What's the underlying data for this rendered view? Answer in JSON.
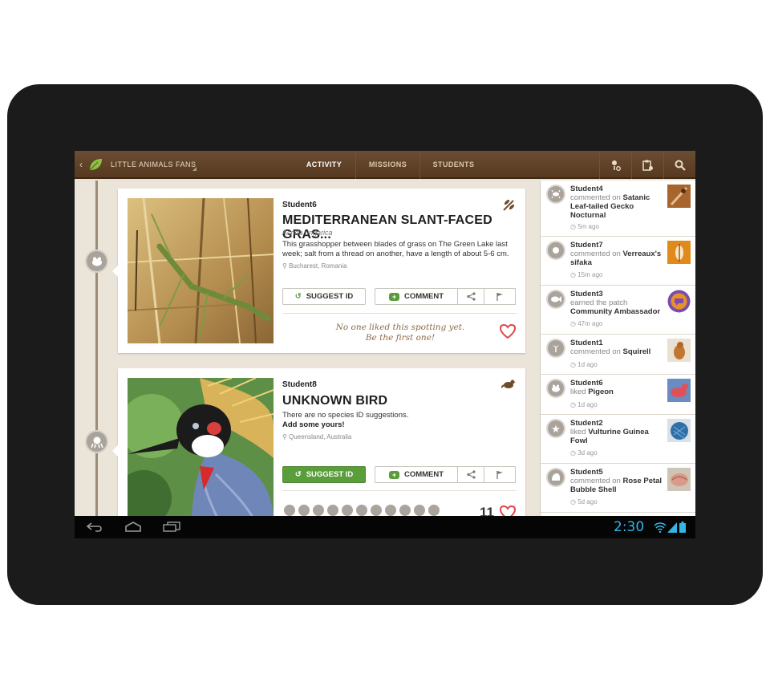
{
  "topbar": {
    "group_name": "LITTLE ANIMALS FANS",
    "tabs": [
      {
        "label": "ACTIVITY",
        "active": true
      },
      {
        "label": "MISSIONS",
        "active": false
      },
      {
        "label": "STUDENTS",
        "active": false
      }
    ],
    "icons": [
      "person-settings-icon",
      "clipboard-icon",
      "search-icon"
    ]
  },
  "feed": {
    "cards": [
      {
        "user": "Student6",
        "title": "MEDITERRANEAN SLANT-FACED GRAS...",
        "scientific": "Acrida ungarica",
        "description": "This grasshopper between blades of grass on The Green Lake last week; salt from a thread on another, have a length of about 5-6 cm.",
        "location": "Bucharest, Romania",
        "category_icon": "dragonfly-icon",
        "suggest_label": "SUGGEST ID",
        "comment_label": "COMMENT",
        "likes_text_1": "No one liked this spotting yet.",
        "likes_text_2": "Be the first one!"
      },
      {
        "user": "Student8",
        "title": "UNKNOWN BIRD",
        "description": "There are no species ID suggestions.",
        "add_prompt": "Add some yours!",
        "location": "Queensland, Australia",
        "category_icon": "bird-icon",
        "suggest_label": "SUGGEST ID",
        "comment_label": "COMMENT",
        "likes_count": "11"
      }
    ]
  },
  "sidebar": {
    "items": [
      {
        "user": "Student4",
        "action": "commented on",
        "target": "Satanic Leaf-tailed Gecko Nocturnal",
        "time": "5m ago"
      },
      {
        "user": "Student7",
        "action": "commented on",
        "target": "Verreaux's sifaka",
        "time": "15m ago"
      },
      {
        "user": "Student3",
        "action": "earned the patch",
        "target": "Community Ambassador",
        "time": "47m ago"
      },
      {
        "user": "Student1",
        "action": "commented on",
        "target": "Squirell",
        "time": "1d ago"
      },
      {
        "user": "Student6",
        "action": "liked",
        "target": "Pigeon",
        "time": "1d ago"
      },
      {
        "user": "Student2",
        "action": "liked",
        "target": "Vulturine Guinea Fowl",
        "time": "3d ago"
      },
      {
        "user": "Student5",
        "action": "commented on",
        "target": "Rose Petal Bubble Shell",
        "time": "5d ago"
      }
    ]
  },
  "system": {
    "clock": "2:30"
  },
  "colors": {
    "topbar": "#5e4027",
    "accent_green": "#5a9d3b",
    "clock_blue": "#33b5e5",
    "heart_red": "#e2474b"
  }
}
